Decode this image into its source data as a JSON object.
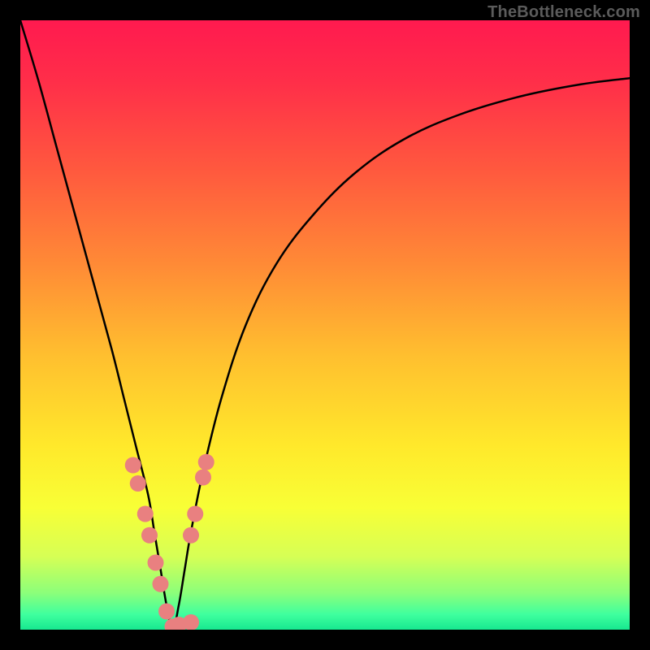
{
  "watermark": "TheBottleneck.com",
  "colors": {
    "frame": "#000000",
    "gradient_stops": [
      {
        "offset": 0.0,
        "color": "#ff1a4f"
      },
      {
        "offset": 0.1,
        "color": "#ff2e49"
      },
      {
        "offset": 0.25,
        "color": "#ff5a3e"
      },
      {
        "offset": 0.4,
        "color": "#ff8a36"
      },
      {
        "offset": 0.55,
        "color": "#ffbf2f"
      },
      {
        "offset": 0.7,
        "color": "#ffe92b"
      },
      {
        "offset": 0.8,
        "color": "#f8ff36"
      },
      {
        "offset": 0.88,
        "color": "#d6ff55"
      },
      {
        "offset": 0.94,
        "color": "#8bff7a"
      },
      {
        "offset": 0.975,
        "color": "#3fff9e"
      },
      {
        "offset": 1.0,
        "color": "#17e890"
      }
    ],
    "curve_stroke": "#000000",
    "marker_fill": "#e98080",
    "watermark_text": "#5b5b5b"
  },
  "chart_data": {
    "type": "line",
    "title": "",
    "xlabel": "",
    "ylabel": "",
    "xlim": [
      0,
      100
    ],
    "ylim": [
      0,
      100
    ],
    "series": [
      {
        "name": "bottleneck-curve",
        "x": [
          0,
          3,
          6,
          9,
          12,
          15,
          17,
          19,
          21,
          22,
          23,
          24,
          25,
          26,
          27,
          28,
          30,
          33,
          37,
          42,
          48,
          55,
          63,
          72,
          82,
          92,
          100
        ],
        "values": [
          100,
          90,
          79,
          68,
          57,
          46,
          38,
          30,
          22,
          16,
          10,
          4,
          0,
          4,
          10,
          16,
          26,
          38,
          50,
          60,
          68,
          75,
          80.5,
          84.5,
          87.5,
          89.5,
          90.5
        ]
      }
    ],
    "markers": [
      {
        "x": 18.5,
        "y": 27.0
      },
      {
        "x": 19.3,
        "y": 24.0
      },
      {
        "x": 20.5,
        "y": 19.0
      },
      {
        "x": 21.2,
        "y": 15.5
      },
      {
        "x": 22.2,
        "y": 11.0
      },
      {
        "x": 23.0,
        "y": 7.5
      },
      {
        "x": 24.0,
        "y": 3.0
      },
      {
        "x": 25.0,
        "y": 0.5
      },
      {
        "x": 26.0,
        "y": 0.8
      },
      {
        "x": 28.0,
        "y": 1.2
      },
      {
        "x": 28.0,
        "y": 15.5
      },
      {
        "x": 28.7,
        "y": 19.0
      },
      {
        "x": 30.0,
        "y": 25.0
      },
      {
        "x": 30.5,
        "y": 27.5
      }
    ],
    "marker_radius": 10
  }
}
